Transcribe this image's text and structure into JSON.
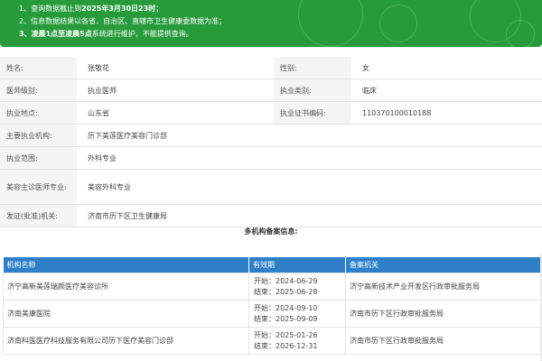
{
  "notice": {
    "line1_prefix": "1、查询数据截止到",
    "line1_bold": "2025年3月30日23时",
    "line1_suffix": "；",
    "line2": "2、信息数据结果以各省、自治区、直辖市卫生健康委数据为准；",
    "line3_bold": "3、凌晨1点至凌晨5点",
    "line3_suffix": "系统进行维护，不能提供查询。"
  },
  "info": {
    "name_label": "姓名:",
    "name": "张敬花",
    "gender_label": "性别:",
    "gender": "女",
    "level_label": "医师级别:",
    "level": "执业医师",
    "category_label": "执业类别:",
    "category": "临床",
    "location_label": "执业地点:",
    "location": "山东省",
    "cert_label": "执业证书编码:",
    "cert": "110370100010188",
    "institution_label": "主要执业机构:",
    "institution": "历下美莲医疗美容门诊部",
    "scope_label": "执业范围:",
    "scope": "外科专业",
    "cosmetic_label": "美容主诊医师专业:",
    "cosmetic": "美容外科专业",
    "issuer_label": "发证(批准)机关:",
    "issuer": "济南市历下区卫生健康局"
  },
  "multi": {
    "title": "多机构备案信息:",
    "headers": {
      "name": "机构名称",
      "period": "有效期",
      "authority": "备案机关"
    },
    "start_prefix": "开始：",
    "end_prefix": "结束：",
    "rows": [
      {
        "name": "济宁高新美莲瑞颜医疗美容诊所",
        "start": "2024-06-29",
        "end": "2025-06-28",
        "authority": "济宁高新技术产业开发区行政审批服务局"
      },
      {
        "name": "济南美康医院",
        "start": "2024-09-10",
        "end": "2025-09-09",
        "authority": "济南市历下区行政审批服务局"
      },
      {
        "name": "济南科医医疗科技服务有限公司历下医疗美容门诊部",
        "start": "2025-01-26",
        "end": "2026-12-31",
        "authority": "济南市历下区行政审批服务局"
      }
    ]
  },
  "colors": {
    "notice_bg": "#279b3b",
    "table_header_bg": "#2f80c9",
    "label_bg": "#f5f5f5"
  }
}
